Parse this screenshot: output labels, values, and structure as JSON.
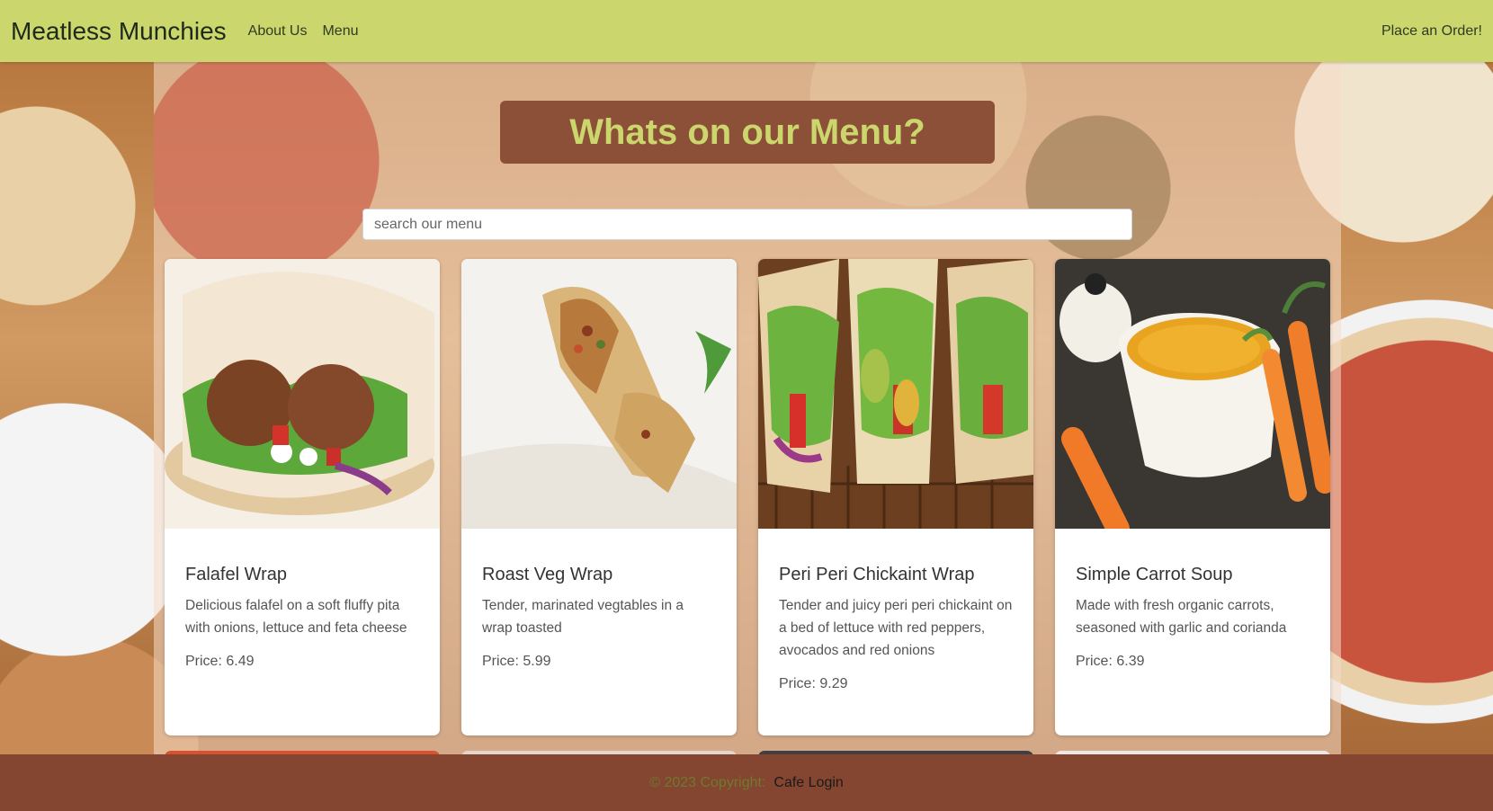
{
  "navbar": {
    "brand": "Meatless Munchies",
    "links": [
      "About Us",
      "Menu"
    ],
    "cta": "Place an Order!"
  },
  "hero": {
    "title": "Whats on our Menu?",
    "search_placeholder": "search our menu"
  },
  "menu_items": [
    {
      "name": "Falafel Wrap",
      "description": "Delicious falafel on a soft fluffy pita with onions, lettuce and feta cheese",
      "price": "Price: 6.49"
    },
    {
      "name": "Roast Veg Wrap",
      "description": "Tender, marinated vegtables in a wrap toasted",
      "price": "Price: 5.99"
    },
    {
      "name": "Peri Peri Chickaint Wrap",
      "description": "Tender and juicy peri peri chickaint on a bed of lettuce with red peppers, avocados and red onions",
      "price": "Price: 9.29"
    },
    {
      "name": "Simple Carrot Soup",
      "description": "Made with fresh organic carrots, seasoned with garlic and corianda",
      "price": "Price: 6.39"
    }
  ],
  "footer": {
    "copyright": "© 2023 Copyright:",
    "login": "Cafe Login"
  },
  "colors": {
    "navbar": "#cbd76d",
    "accent_brown": "#844630",
    "title_text": "#cbd76d"
  }
}
